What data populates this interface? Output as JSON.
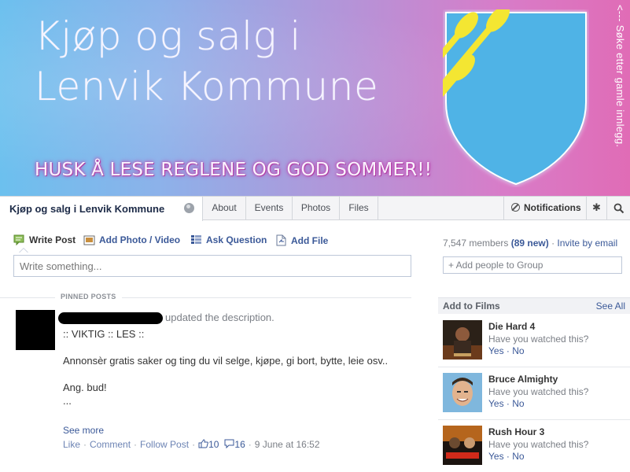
{
  "cover": {
    "title_line1": "Kjøp og salg i",
    "title_line2": "Lenvik Kommune",
    "tagline": "HUSK Å LESE REGLENE OG GOD SOMMER!!",
    "vertical_note": "<--- Søke etter gamle innlegg.",
    "colors": {
      "left": "#6cc0ee",
      "right": "#e06cb6",
      "shield": "#4fb3e6",
      "oars": "#f4e632"
    }
  },
  "nav": {
    "group_name": "Kjøp og salg i Lenvik Kommune",
    "tabs": [
      "About",
      "Events",
      "Photos",
      "Files"
    ],
    "notifications": "Notifications"
  },
  "composer": {
    "write_post": "Write Post",
    "add_photo": "Add Photo / Video",
    "ask_question": "Ask Question",
    "add_file": "Add File",
    "placeholder": "Write something..."
  },
  "pinned": {
    "label": "PINNED POSTS",
    "action": "updated the description.",
    "body": [
      ":: VIKTIG :: LES ::",
      "Annonsèr gratis saker og ting du vil selge, kjøpe, gi bort, bytte, leie osv..",
      "Ang. bud!",
      "..."
    ],
    "see_more": "See more",
    "footer": {
      "like": "Like",
      "comment": "Comment",
      "follow": "Follow Post",
      "likes_count": "10",
      "comments_count": "16",
      "date": "9 June at 16:52"
    }
  },
  "sidebar": {
    "members_count": "7,547 members",
    "members_new": "(89 new)",
    "invite": "Invite by email",
    "add_people": "+ Add people to Group",
    "films_title": "Add to Films",
    "see_all": "See All",
    "films": [
      {
        "title": "Die Hard 4",
        "question": "Have you watched this?",
        "yes": "Yes",
        "no": "No"
      },
      {
        "title": "Bruce Almighty",
        "question": "Have you watched this?",
        "yes": "Yes",
        "no": "No"
      },
      {
        "title": "Rush Hour 3",
        "question": "Have you watched this?",
        "yes": "Yes",
        "no": "No"
      }
    ]
  }
}
